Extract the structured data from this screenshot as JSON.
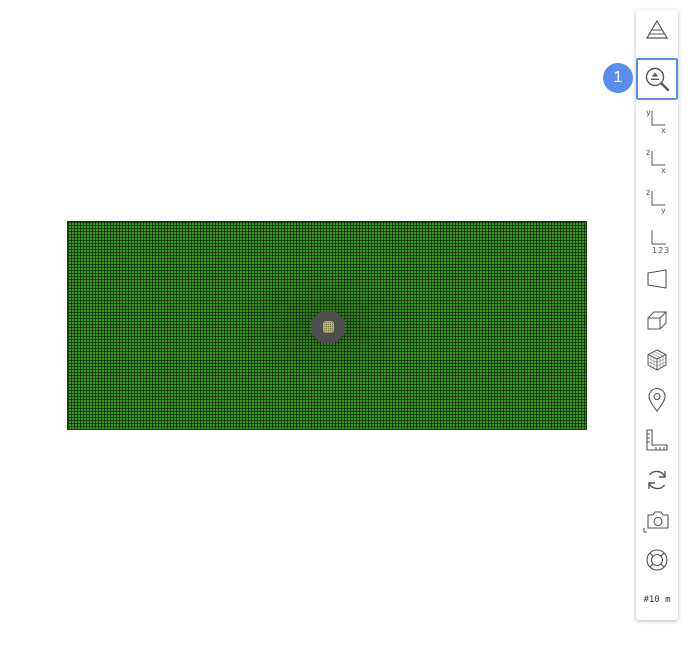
{
  "viewport": {
    "mesh_color": "#3c9a1f",
    "hole_color": "#4f4f4f"
  },
  "toolbar": {
    "accent_color": "#5b8def",
    "active_tool": "zoom-fit",
    "tools": [
      {
        "id": "perspective",
        "icon": "pyramid-icon"
      },
      {
        "id": "zoom-fit",
        "icon": "zoom-fit-icon"
      },
      {
        "id": "view-xy",
        "icon": "axes-xy-icon",
        "axis_v": "y",
        "axis_h": "x"
      },
      {
        "id": "view-zx",
        "icon": "axes-zx-icon",
        "axis_v": "z",
        "axis_h": "x"
      },
      {
        "id": "view-zy",
        "icon": "axes-zy-icon",
        "axis_v": "z",
        "axis_h": "y"
      },
      {
        "id": "view-123",
        "icon": "axes-123-icon",
        "axis_h": "123"
      },
      {
        "id": "face",
        "icon": "face-icon"
      },
      {
        "id": "box",
        "icon": "box-icon"
      },
      {
        "id": "cube",
        "icon": "cube-icon"
      },
      {
        "id": "pin",
        "icon": "location-pin-icon"
      },
      {
        "id": "ruler",
        "icon": "ruler-icon"
      },
      {
        "id": "rotate",
        "icon": "rotate-icon"
      },
      {
        "id": "screenshot",
        "icon": "camera-icon"
      },
      {
        "id": "orbit",
        "icon": "lifebuoy-icon"
      },
      {
        "id": "scale",
        "icon": "scale-bar-icon",
        "label": "#10 m"
      }
    ]
  },
  "callout": {
    "number": "1"
  }
}
